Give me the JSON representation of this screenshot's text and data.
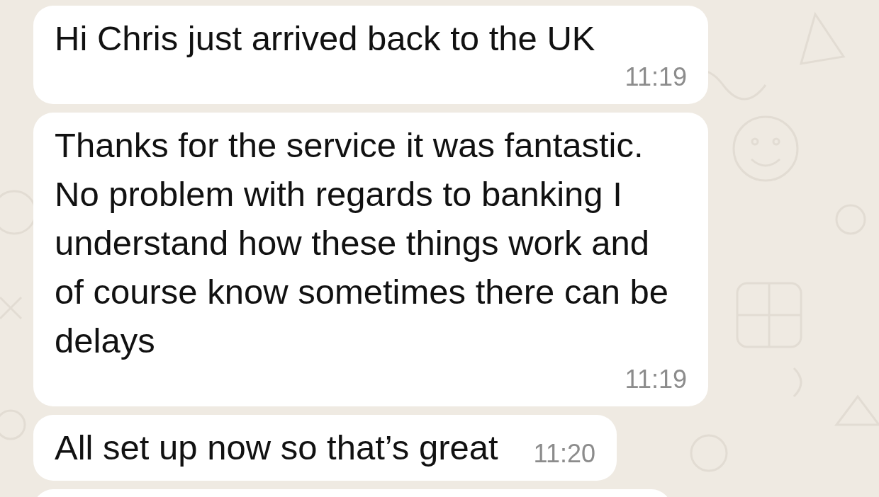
{
  "messages": [
    {
      "kind": "message",
      "text": "Hi Chris just arrived back to the UK",
      "time": "11:19"
    },
    {
      "kind": "message",
      "text": "Thanks for the service it was fantastic. No problem with regards to banking I understand how these things work and of course know sometimes there can be delays",
      "time": "11:19"
    },
    {
      "kind": "message",
      "text": "All set up now so that’s great",
      "time": "11:20"
    },
    {
      "kind": "cut"
    }
  ]
}
